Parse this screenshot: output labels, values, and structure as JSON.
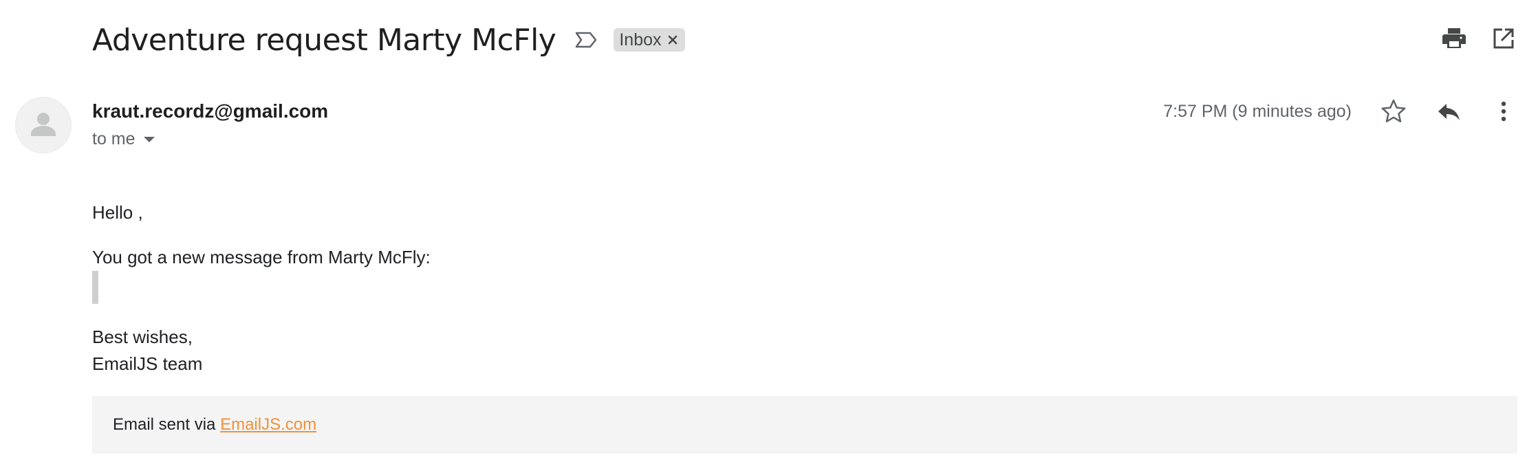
{
  "email": {
    "subject": "Adventure request Marty McFly",
    "label": "Inbox",
    "sender": "kraut.recordz@gmail.com",
    "recipient": "to me",
    "timestamp": "7:57 PM (9 minutes ago)",
    "body": {
      "greeting": "Hello ,",
      "intro": "You got a new message from Marty McFly:",
      "quote": "",
      "signoff_line1": "Best wishes,",
      "signoff_line2": "EmailJS team"
    },
    "footer": {
      "prefix": "Email sent via ",
      "link_text": "EmailJS.com"
    }
  },
  "icons": {
    "important": "important-marker-icon",
    "label_remove": "close-icon",
    "print": "print-icon",
    "popout": "open-in-new-window-icon",
    "avatar": "person-icon",
    "star": "star-icon",
    "reply": "reply-icon",
    "more": "more-vert-icon"
  },
  "colors": {
    "link": "#f0913a",
    "label_chip": "#dddddd",
    "footer_bg": "#f4f4f4"
  }
}
